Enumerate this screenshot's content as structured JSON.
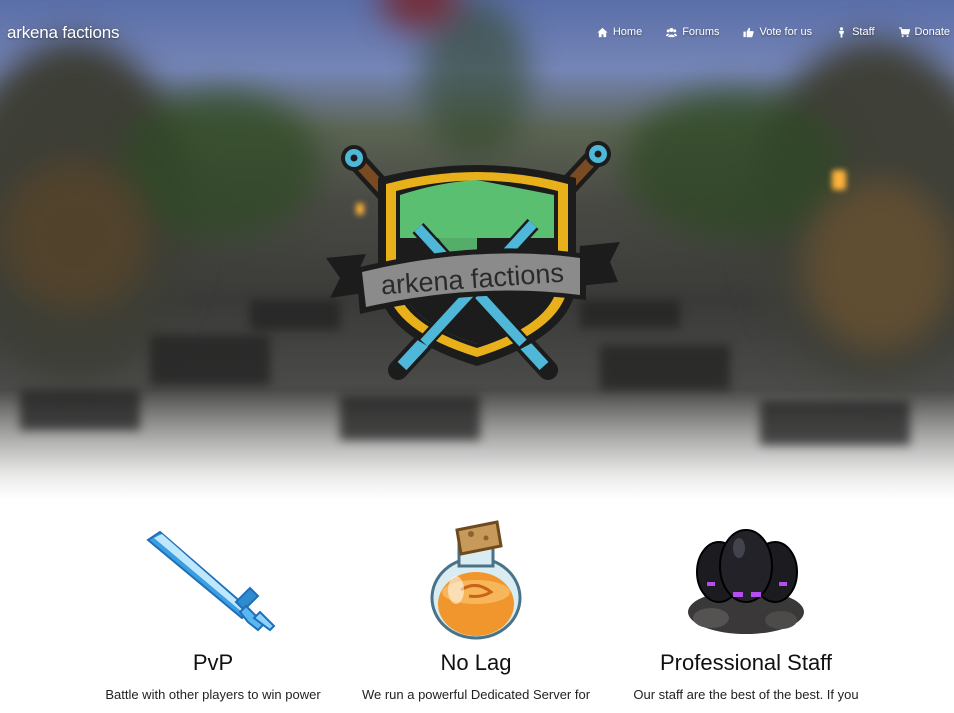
{
  "brand": {
    "name": "arkena factions"
  },
  "nav": {
    "items": [
      {
        "label": "Home",
        "icon": "home-icon"
      },
      {
        "label": "Forums",
        "icon": "users-icon"
      },
      {
        "label": "Vote for us",
        "icon": "thumbs-up-icon"
      },
      {
        "label": "Staff",
        "icon": "user-staff-icon"
      },
      {
        "label": "Donate",
        "icon": "cart-icon"
      }
    ]
  },
  "hero": {
    "logo_text": "arkena factions",
    "colors": {
      "shield_gold": "#e8b11c",
      "shield_green": "#5bbf72",
      "shield_dark": "#1c1c1c",
      "blade": "#4fb8d8",
      "banner": "#8b8b8b"
    }
  },
  "features": [
    {
      "title": "PvP",
      "text": "Battle with other players to win power",
      "icon": "diamond-sword-icon"
    },
    {
      "title": "No Lag",
      "text": "We run a powerful Dedicated Server for",
      "icon": "potion-icon"
    },
    {
      "title": "Professional Staff",
      "text": "Our staff are the best of the best. If you",
      "icon": "ender-eggs-icon"
    }
  ]
}
